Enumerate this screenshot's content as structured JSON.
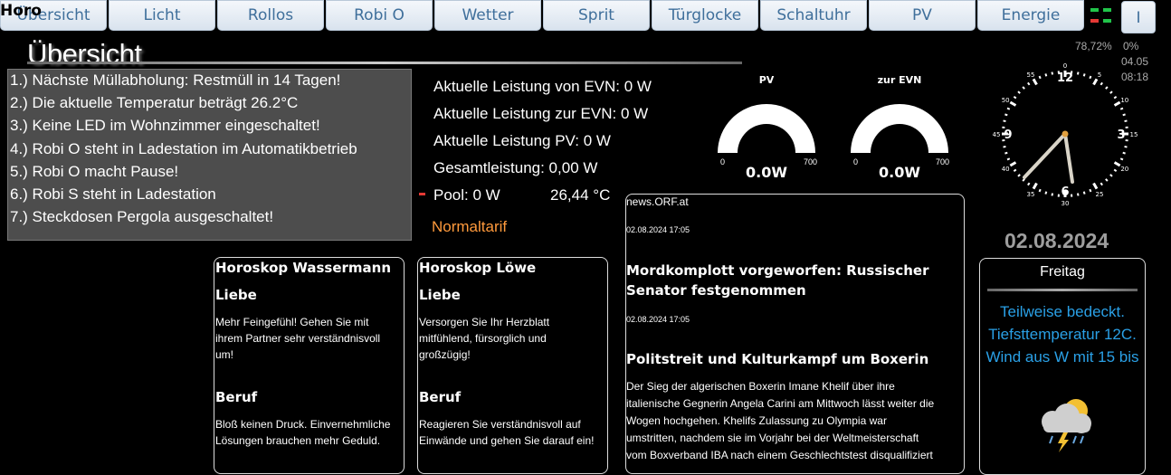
{
  "nav": {
    "tabs": [
      "Übersicht",
      "Licht",
      "Rollos",
      "Robi O",
      "Wetter",
      "Sprit",
      "Türglocke",
      "Schaltuhr",
      "PV",
      "Energie"
    ],
    "page_label": "Horo",
    "user_button": "I"
  },
  "page": {
    "title": "Übersicht"
  },
  "messages": [
    "1.) Nächste Müllabholung: Restmüll in 14 Tagen!",
    "2.) Die aktuelle Temperatur beträgt 26.2°C",
    "3.) Keine LED im Wohnzimmer eingeschaltet!",
    "4.) Robi O steht in Ladestation im Automatikbetrieb",
    "5.) Robi O macht Pause!",
    "6.) Robi S steht in Ladestation",
    "7.) Steckdosen Pergola ausgeschaltet!"
  ],
  "power": {
    "from_evn": "Aktuelle Leistung von EVN: 0 W",
    "to_evn": "Aktuelle Leistung zur EVN: 0 W",
    "pv": "Aktuelle Leistung PV: 0 W",
    "total": "Gesamtleistung: 0,00 W",
    "pool": "Pool: 0 W",
    "pool_temp": "26,44 °C",
    "tariff": "Normaltarif"
  },
  "gauges": [
    {
      "title": "PV",
      "value": "0.0W",
      "min": "0",
      "max": "700",
      "level": 0
    },
    {
      "title": "zur EVN",
      "value": "0.0W",
      "min": "0",
      "max": "700",
      "level": 0
    }
  ],
  "system": {
    "cpu": "78,72%",
    "load": "0%",
    "date_short": "04.05",
    "time_short": "08:18"
  },
  "clock": {
    "numbers": [
      "12",
      "3",
      "6",
      "9"
    ],
    "minute_marks": [
      "0",
      "5",
      "10",
      "15",
      "20",
      "25",
      "30",
      "35",
      "40",
      "45",
      "50",
      "55"
    ]
  },
  "date": "02.08.2024",
  "weather": {
    "day": "Freitag",
    "lines": [
      "Teilweise bedeckt.",
      "Tiefsttemperatur 12C.",
      "Wind aus W mit 15 bis"
    ]
  },
  "horoscope": [
    {
      "title": "Horoskop Wassermann",
      "sections": [
        {
          "heading": "Liebe",
          "text": [
            "Mehr Feingefühl! Gehen Sie mit",
            "ihrem Partner sehr verständnisvoll",
            "um!"
          ]
        },
        {
          "heading": "Beruf",
          "text": [
            "Bloß keinen Druck. Einvernehmliche",
            "Lösungen brauchen mehr Geduld."
          ]
        }
      ]
    },
    {
      "title": "Horoskop Löwe",
      "sections": [
        {
          "heading": "Liebe",
          "text": [
            "Versorgen Sie Ihr Herzblatt",
            "mitfühlend, fürsorglich und",
            "großzügig!"
          ]
        },
        {
          "heading": "Beruf",
          "text": [
            "Reagieren Sie verständnisvoll auf",
            "Einwände und gehen Sie darauf ein!"
          ]
        }
      ]
    }
  ],
  "news": {
    "source": "news.ORF.at",
    "items": [
      {
        "time": "02.08.2024 17:05",
        "headline": [
          "Mordkomplott vorgeworfen: Russischer",
          "Senator festgenommen"
        ]
      },
      {
        "time": "02.08.2024 17:05",
        "headline": [
          "Politstreit und Kulturkampf um Boxerin"
        ],
        "body": [
          "Der Sieg der algerischen Boxerin Imane Khelif über ihre",
          "italienische Gegnerin Angela Carini am Mittwoch lässt weiter die",
          "Wogen hochgehen. Khelifs Zulassung zu Olympia war",
          "umstritten, nachdem sie im Vorjahr bei der Weltmeisterschaft",
          "vom Boxverband IBA nach einem Geschlechtstest disqualifiziert"
        ]
      }
    ]
  },
  "colors": {
    "accent": "#3f6f9b",
    "weather_text": "#2aa0e6",
    "tariff": "#ff9a3c",
    "status_green": "#21c44a",
    "status_red": "#e53935"
  }
}
